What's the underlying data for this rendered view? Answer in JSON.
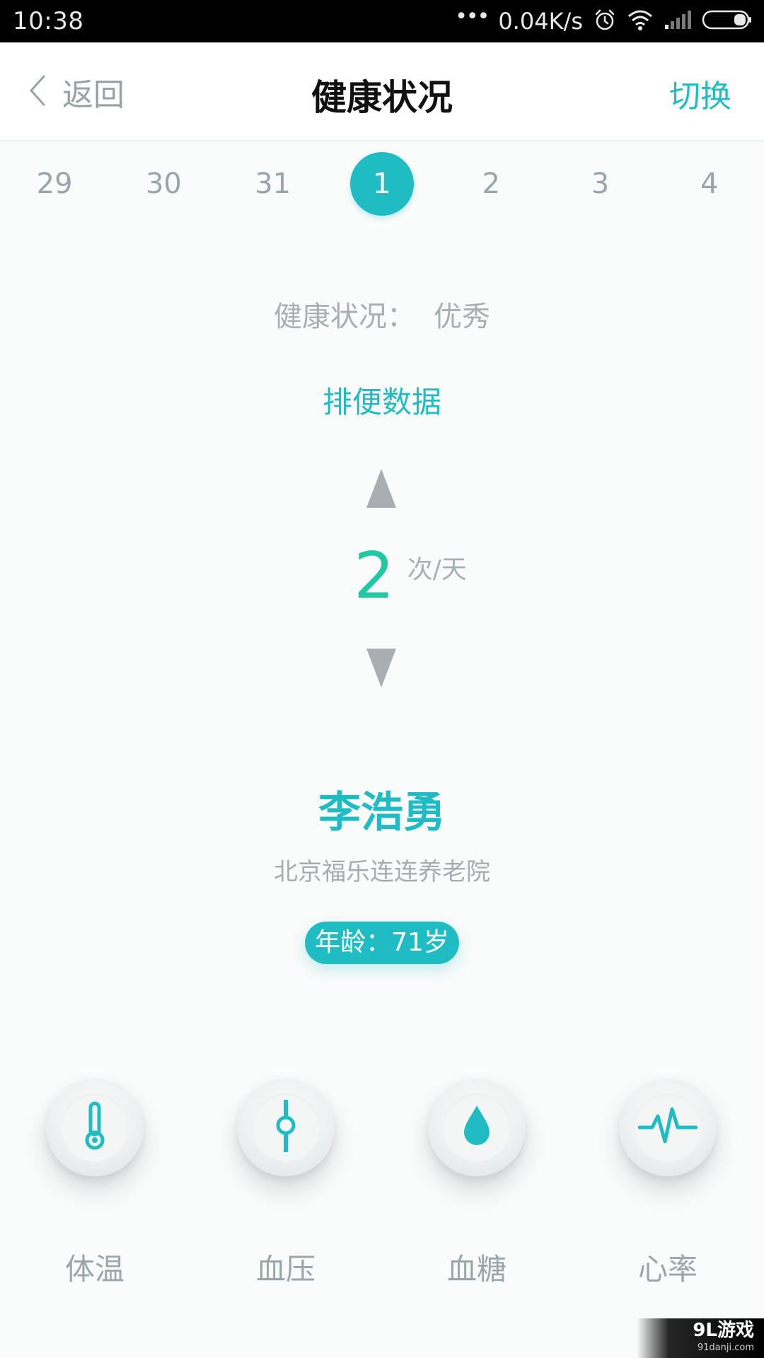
{
  "status_bar": {
    "time": "10:38",
    "dots": "•••",
    "network_speed": "0.04K/s"
  },
  "header": {
    "back_label": "返回",
    "title": "健康状况",
    "switch_label": "切换"
  },
  "dates": [
    "29",
    "30",
    "31",
    "1",
    "2",
    "3",
    "4"
  ],
  "selected_date": "1",
  "health": {
    "label": "健康状况：",
    "value": "优秀"
  },
  "data_type": "排便数据",
  "measurement": {
    "value": "2",
    "unit": "次/天"
  },
  "person": {
    "name": "李浩勇",
    "institution": "北京福乐连连养老院",
    "age_label": "年龄：71岁"
  },
  "metrics": [
    {
      "label": "体温",
      "icon": "thermometer-icon"
    },
    {
      "label": "血压",
      "icon": "blood-pressure-icon"
    },
    {
      "label": "血糖",
      "icon": "blood-drop-icon"
    },
    {
      "label": "心率",
      "icon": "heartbeat-icon"
    }
  ],
  "colors": {
    "accent": "#1fbdc3",
    "value_green": "#1fc9a4",
    "muted_text": "#a8afb2"
  },
  "watermark": {
    "brand": "9L游戏",
    "url": "91danji.com"
  }
}
